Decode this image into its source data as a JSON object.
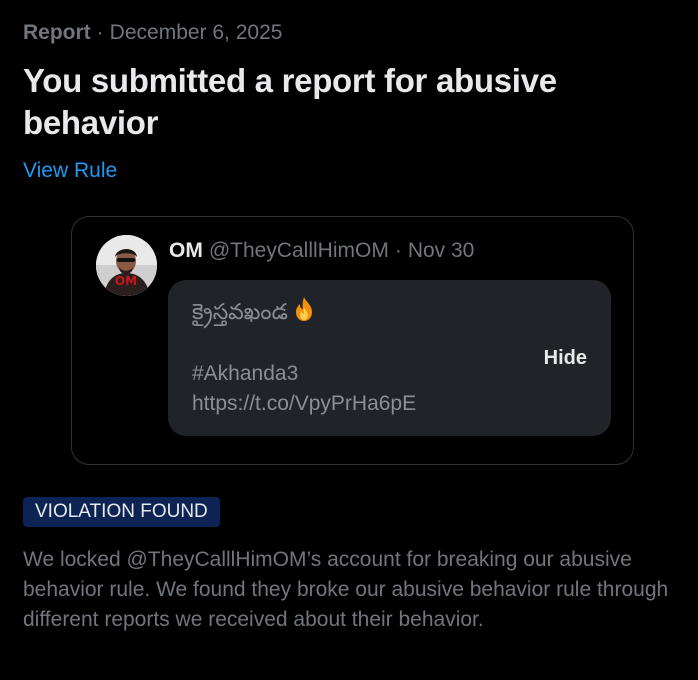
{
  "header": {
    "report_label": "Report",
    "separator": "·",
    "date": "December 6, 2025"
  },
  "title": "You submitted a report for abusive behavior",
  "view_rule_label": "View Rule",
  "tweet": {
    "author_name": "OM",
    "handle": "@TheyCalllHimOM",
    "separator": "·",
    "date": "Nov 30",
    "text_line1": "క్రైస్తవఖండ",
    "hashtag": "#Akhanda3",
    "link": "https://t.co/VpyPrHa6pE",
    "hide_label": "Hide",
    "avatar_logo_text": "OM"
  },
  "status_badge": "VIOLATION FOUND",
  "explanation": "We locked @TheyCalllHimOM’s account for breaking our abusive behavior rule. We found they broke our abusive behavior rule through different reports we received about their behavior.",
  "colors": {
    "background": "#000000",
    "text_primary": "#e7e9ea",
    "text_secondary": "#71767b",
    "link": "#1d9bf0",
    "badge_bg": "#0c2354",
    "tweet_body_bg": "#202327",
    "card_border": "#2f3336"
  },
  "icons": {
    "emoji": "fire-icon",
    "avatar": "profile-photo"
  }
}
